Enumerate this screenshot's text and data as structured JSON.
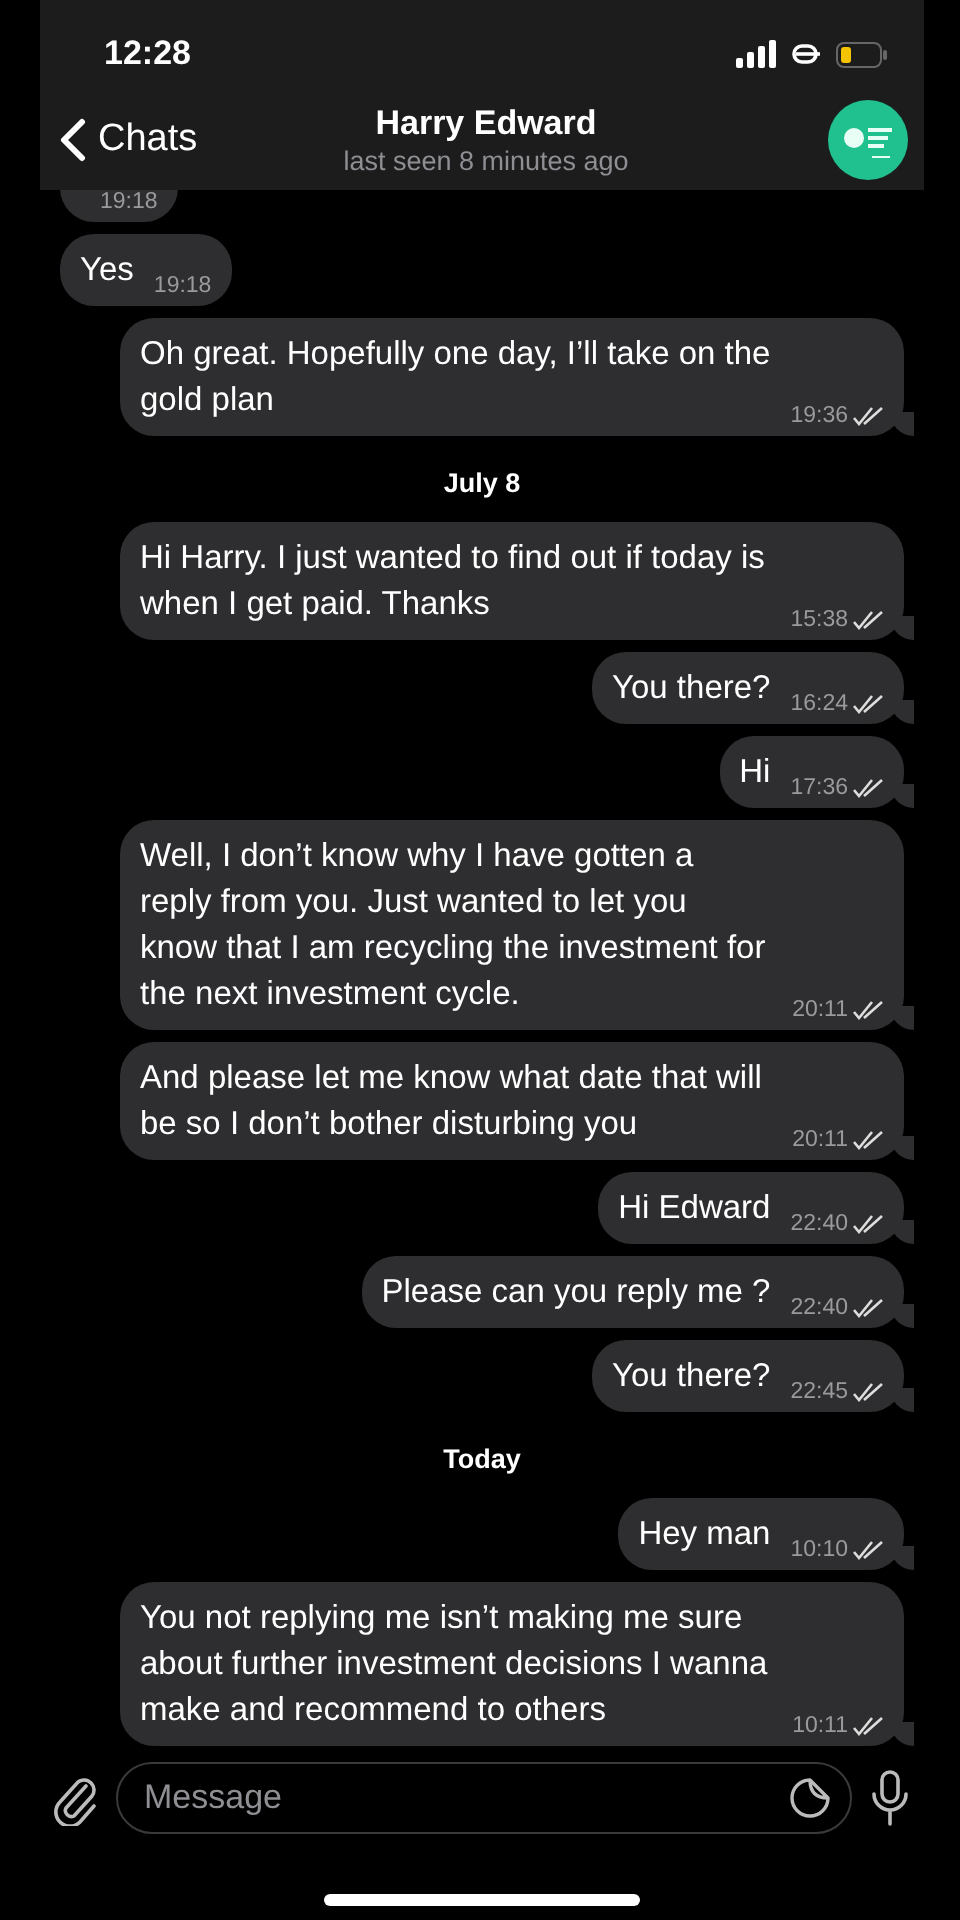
{
  "status_bar": {
    "time": "12:28"
  },
  "header": {
    "back_label": "Chats",
    "title": "Harry Edward",
    "subtitle": "last seen 8 minutes ago"
  },
  "messages": [
    {
      "kind": "cut",
      "time": "19:18"
    },
    {
      "kind": "incoming",
      "text": "Yes",
      "time": "19:18"
    },
    {
      "kind": "outgoing",
      "text": "Oh great. Hopefully one day, I’ll take on the gold plan",
      "time": "19:36"
    },
    {
      "kind": "date",
      "text": "July 8"
    },
    {
      "kind": "outgoing",
      "text": "Hi Harry. I just wanted to find out if today is when I get paid. Thanks",
      "time": "15:38"
    },
    {
      "kind": "outgoing",
      "text": "You there?",
      "time": "16:24"
    },
    {
      "kind": "outgoing",
      "text": "Hi",
      "time": "17:36"
    },
    {
      "kind": "outgoing",
      "text": "Well, I don’t know why I have gotten a reply from you. Just wanted to let you know that I am recycling the investment  for the next investment cycle.",
      "time": "20:11"
    },
    {
      "kind": "outgoing",
      "text": "And please let me know what date that will be so I don’t bother disturbing you",
      "time": "20:11"
    },
    {
      "kind": "outgoing",
      "text": "Hi Edward",
      "time": "22:40"
    },
    {
      "kind": "outgoing",
      "text": "Please can you reply me ?",
      "time": "22:40"
    },
    {
      "kind": "outgoing",
      "text": "You there?",
      "time": "22:45"
    },
    {
      "kind": "date",
      "text": "Today"
    },
    {
      "kind": "outgoing",
      "text": "Hey man",
      "time": "10:10"
    },
    {
      "kind": "outgoing",
      "text": "You not replying me isn’t making me sure about further investment decisions I wanna make and recommend to others",
      "time": "10:11"
    }
  ],
  "composer": {
    "placeholder": "Message"
  }
}
